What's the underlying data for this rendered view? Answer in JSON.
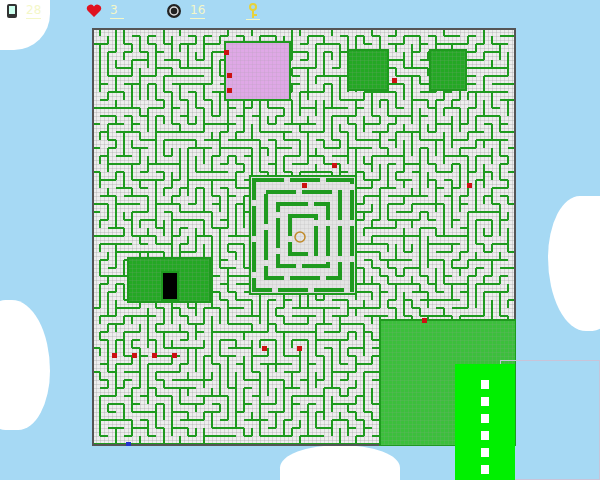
{
  "hud": {
    "moves": "28",
    "lives": "3",
    "coins": "16"
  }
}
